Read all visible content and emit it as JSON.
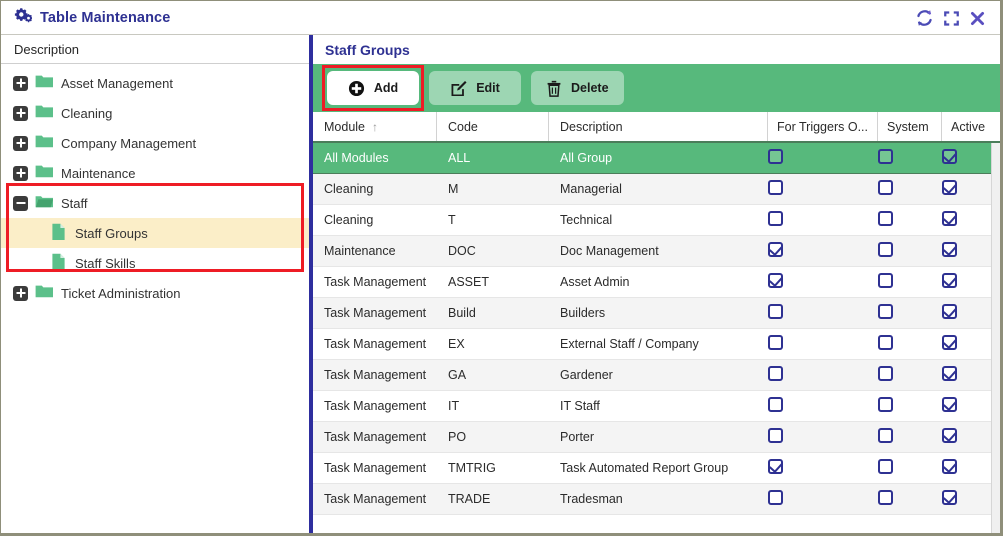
{
  "window": {
    "title": "Table Maintenance",
    "icon": "cogs-icon",
    "controls": [
      {
        "name": "refresh-icon",
        "label": "Refresh"
      },
      {
        "name": "maximize-icon",
        "label": "Maximize"
      },
      {
        "name": "close-icon",
        "label": "Close"
      }
    ]
  },
  "sidebar": {
    "header": "Description",
    "highlight_color": "#ee1c25",
    "selected_color": "#fbeec8",
    "items": [
      {
        "label": "Asset Management",
        "type": "folder",
        "expander": "plus",
        "level": 0,
        "selected": false
      },
      {
        "label": "Cleaning",
        "type": "folder",
        "expander": "plus",
        "level": 0,
        "selected": false
      },
      {
        "label": "Company Management",
        "type": "folder",
        "expander": "plus",
        "level": 0,
        "selected": false
      },
      {
        "label": "Maintenance",
        "type": "folder",
        "expander": "plus",
        "level": 0,
        "selected": false
      },
      {
        "label": "Staff",
        "type": "folder-open",
        "expander": "minus",
        "level": 0,
        "selected": false
      },
      {
        "label": "Staff Groups",
        "type": "document",
        "expander": "none",
        "level": 1,
        "selected": true
      },
      {
        "label": "Staff Skills",
        "type": "document",
        "expander": "none",
        "level": 1,
        "selected": false
      },
      {
        "label": "Ticket Administration",
        "type": "folder",
        "expander": "plus",
        "level": 0,
        "selected": false
      }
    ]
  },
  "main": {
    "title": "Staff Groups",
    "toolbar": {
      "background": "#57b97c",
      "buttons": [
        {
          "label": "Add",
          "icon": "plus-circle-icon",
          "highlighted": true
        },
        {
          "label": "Edit",
          "icon": "pencil-square-icon",
          "highlighted": false
        },
        {
          "label": "Delete",
          "icon": "trash-icon",
          "highlighted": false
        }
      ]
    },
    "grid": {
      "columns": [
        {
          "label": "Module",
          "sort": "asc",
          "class": "c-module"
        },
        {
          "label": "Code",
          "sort": "none",
          "class": "c-code"
        },
        {
          "label": "Description",
          "sort": "none",
          "class": "c-desc"
        },
        {
          "label": "For Triggers O...",
          "sort": "none",
          "class": "c-trig"
        },
        {
          "label": "System",
          "sort": "none",
          "class": "c-sys"
        },
        {
          "label": "Active",
          "sort": "none",
          "class": "c-act"
        }
      ],
      "rows": [
        {
          "module": "All Modules",
          "code": "ALL",
          "description": "All Group",
          "triggers": false,
          "system": false,
          "active": true,
          "selected": true
        },
        {
          "module": "Cleaning",
          "code": "M",
          "description": "Managerial",
          "triggers": false,
          "system": false,
          "active": true,
          "selected": false
        },
        {
          "module": "Cleaning",
          "code": "T",
          "description": "Technical",
          "triggers": false,
          "system": false,
          "active": true,
          "selected": false
        },
        {
          "module": "Maintenance",
          "code": "DOC",
          "description": "Doc Management",
          "triggers": true,
          "system": false,
          "active": true,
          "selected": false
        },
        {
          "module": "Task Management",
          "code": "ASSET",
          "description": "Asset Admin",
          "triggers": true,
          "system": false,
          "active": true,
          "selected": false
        },
        {
          "module": "Task Management",
          "code": "Build",
          "description": "Builders",
          "triggers": false,
          "system": false,
          "active": true,
          "selected": false
        },
        {
          "module": "Task Management",
          "code": "EX",
          "description": "External Staff / Company",
          "triggers": false,
          "system": false,
          "active": true,
          "selected": false
        },
        {
          "module": "Task Management",
          "code": "GA",
          "description": "Gardener",
          "triggers": false,
          "system": false,
          "active": true,
          "selected": false
        },
        {
          "module": "Task Management",
          "code": "IT",
          "description": "IT Staff",
          "triggers": false,
          "system": false,
          "active": true,
          "selected": false
        },
        {
          "module": "Task Management",
          "code": "PO",
          "description": "Porter",
          "triggers": false,
          "system": false,
          "active": true,
          "selected": false
        },
        {
          "module": "Task Management",
          "code": "TMTRIG",
          "description": "Task Automated Report Group",
          "triggers": true,
          "system": false,
          "active": true,
          "selected": false
        },
        {
          "module": "Task Management",
          "code": "TRADE",
          "description": "Tradesman",
          "triggers": false,
          "system": false,
          "active": true,
          "selected": false
        }
      ]
    }
  },
  "colors": {
    "accent_green": "#57b97c",
    "accent_navy": "#2e3192",
    "highlight_red": "#ee1c25",
    "selected_row_yellow": "#fbeec8"
  }
}
